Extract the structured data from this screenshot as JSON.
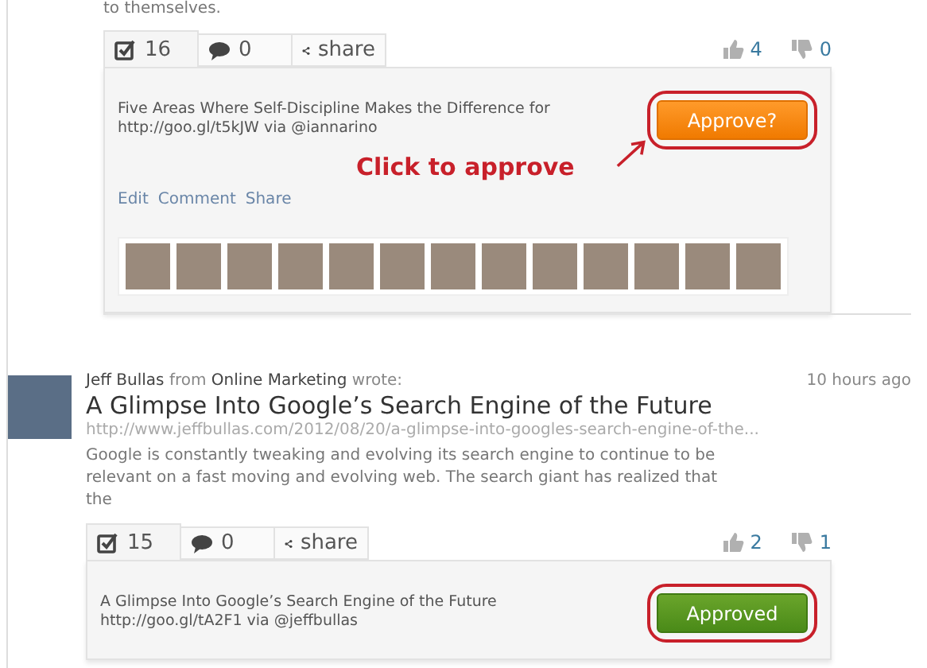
{
  "posts": [
    {
      "excerpt_tail": "to themselves.",
      "tabs": [
        {
          "label": "16",
          "kind": "approvals",
          "selected": true
        },
        {
          "label": "0",
          "kind": "comments",
          "selected": false
        },
        {
          "label": "share",
          "kind": "share",
          "selected": false
        }
      ],
      "likes": "4",
      "dislikes": "0",
      "tweet": "Five Areas Where Self-Discipline Makes the Difference for http://goo.gl/t5kJW via @iannarino",
      "approval": {
        "label": "Approve?",
        "kind": "pending",
        "highlighted": true
      },
      "annotation": "Click to approve",
      "actions": [
        "Edit",
        "Comment",
        "Share"
      ],
      "approver_strip": true
    },
    {
      "author": {
        "name": "Jeff Bullas",
        "from": "from",
        "group": "Online Marketing",
        "wrote": "wrote:",
        "time": "10 hours ago"
      },
      "title": "A Glimpse Into Google’s Search Engine of the Future",
      "url": "http://www.jeffbullas.com/2012/08/20/a-glimpse-into-googles-search-engine-of-the...",
      "excerpt": "Google is constantly tweaking and evolving its search engine to continue to be relevant on a fast moving and evolving web. The search giant has realized that the",
      "tabs": [
        {
          "label": "15",
          "kind": "approvals",
          "selected": true
        },
        {
          "label": "0",
          "kind": "comments",
          "selected": false
        },
        {
          "label": "share",
          "kind": "share",
          "selected": false
        }
      ],
      "likes": "2",
      "dislikes": "1",
      "tweet": "A Glimpse Into Google’s Search Engine of the Future http://goo.gl/tA2F1 via @jeffbullas",
      "approval": {
        "label": "Approved",
        "kind": "approved",
        "highlighted": true
      }
    }
  ]
}
